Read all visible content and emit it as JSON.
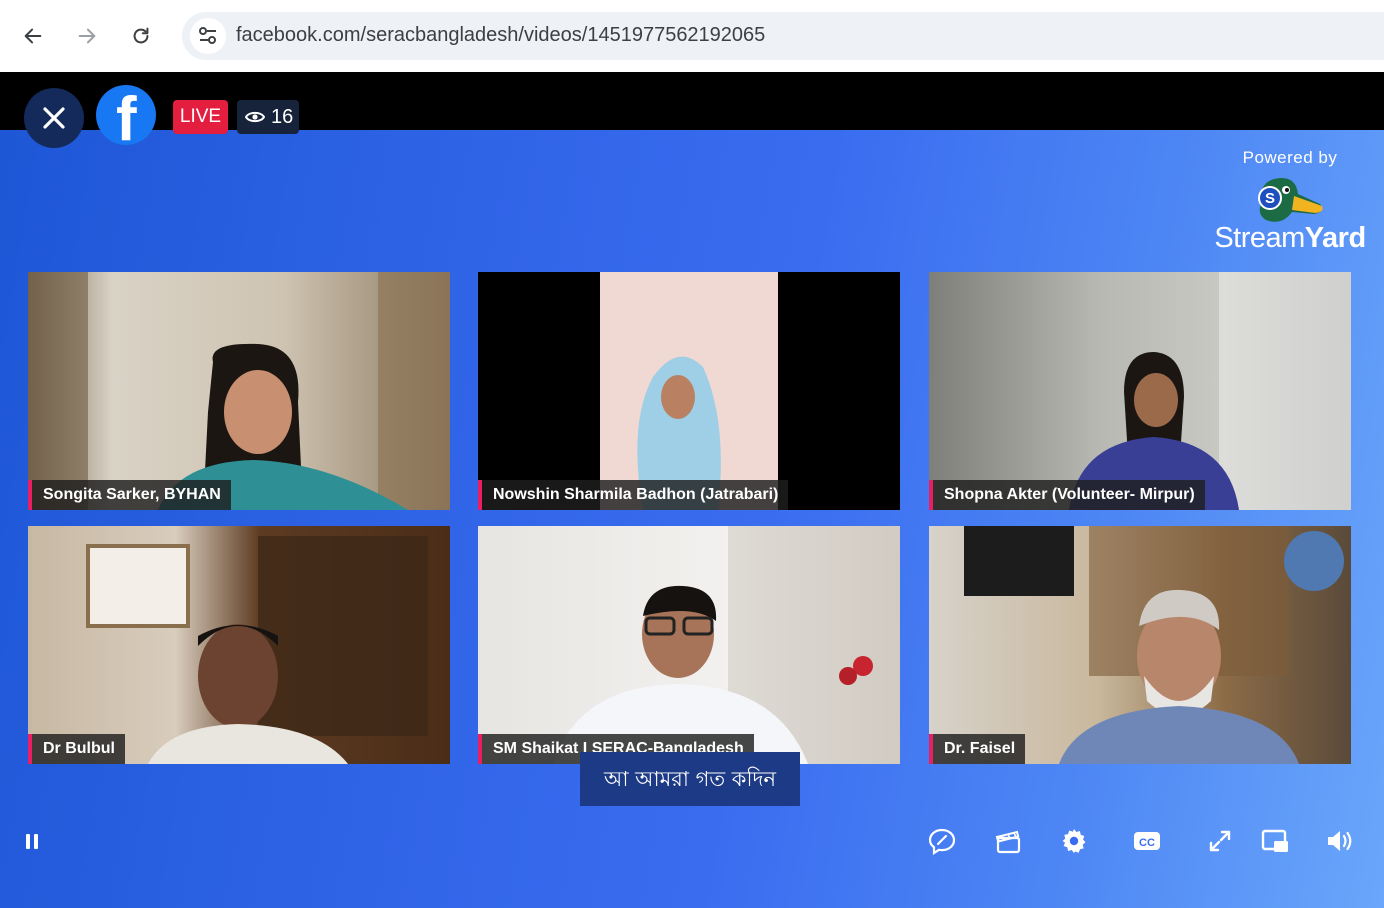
{
  "browser": {
    "url": "facebook.com/seracbangladesh/videos/1451977562192065"
  },
  "player": {
    "live_label": "LIVE",
    "viewer_count": "16",
    "powered_by": "Powered by",
    "brand_stream": "Stream",
    "brand_yard": "Yard",
    "caption": "আ আমরা গত কদিন",
    "colors": {
      "live": "#e41e3f",
      "name_accent": "#e91e63",
      "facebook": "#1877f2"
    }
  },
  "participants": [
    {
      "name": "Songita Sarker, BYHAN"
    },
    {
      "name": "Nowshin Sharmila Badhon (Jatrabari)"
    },
    {
      "name": "Shopna Akter (Volunteer- Mirpur)"
    },
    {
      "name": "Dr Bulbul"
    },
    {
      "name": "SM Shaikat I SERAC-Bangladesh"
    },
    {
      "name": "Dr. Faisel"
    }
  ],
  "controls": [
    "pause-icon",
    "comment-icon",
    "clips-icon",
    "settings-icon",
    "closed-captions-icon",
    "fullscreen-icon",
    "picture-in-picture-icon",
    "volume-icon"
  ]
}
